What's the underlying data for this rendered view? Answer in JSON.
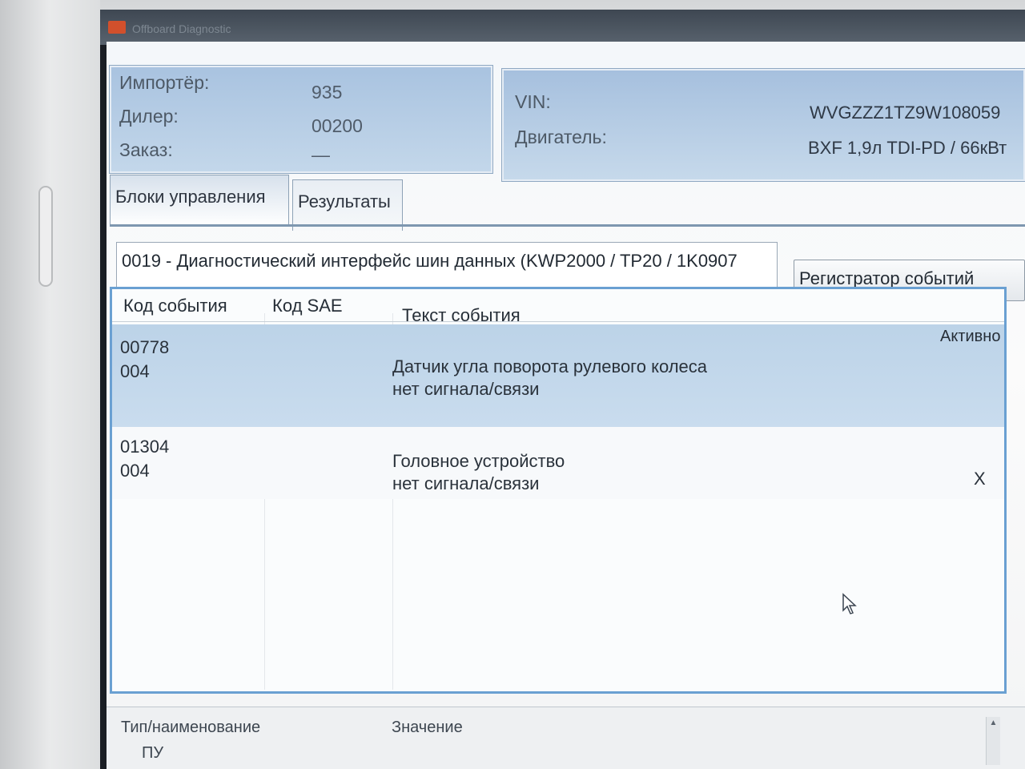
{
  "window": {
    "title": "Offboard Diagnostic"
  },
  "header": {
    "importer_label": "Импортёр:",
    "importer_value": "935",
    "dealer_label": "Дилер:",
    "dealer_value": "00200",
    "order_label": "Заказ:",
    "order_value": "—",
    "vin_label": "VIN:",
    "vin_value": "WVGZZZ1TZ9W108059",
    "engine_label": "Двигатель:",
    "engine_value": "BXF 1,9л TDI-PD / 66кВт"
  },
  "tabs": [
    {
      "label": "Блоки управления",
      "active": true
    },
    {
      "label": "Результаты",
      "active": false
    }
  ],
  "module": {
    "title": "0019 - Диагностический интерфейс шин данных  (KWP2000 / TP20 / 1K0907",
    "events_button": "Регистратор событий"
  },
  "table": {
    "columns": [
      "Код события",
      "Код SAE",
      "Текст события"
    ],
    "active_column": "Активно",
    "rows": [
      {
        "code": "00778",
        "subcode": "004",
        "sae": "",
        "text_line1": "Датчик угла поворота рулевого колеса",
        "text_line2": "нет сигнала/связи",
        "active": ""
      },
      {
        "code": "01304",
        "subcode": "004",
        "sae": "",
        "text_line1": "Головное устройство",
        "text_line2": "нет сигнала/связи",
        "active": "X"
      }
    ]
  },
  "detail": {
    "col_type": "Тип/наименование",
    "col_value": "Значение",
    "first_item": "ПУ"
  },
  "colors": {
    "panel_blue": "#a9c3e0",
    "selection_blue": "#bcd3e8",
    "table_border": "#6aa0d2"
  }
}
